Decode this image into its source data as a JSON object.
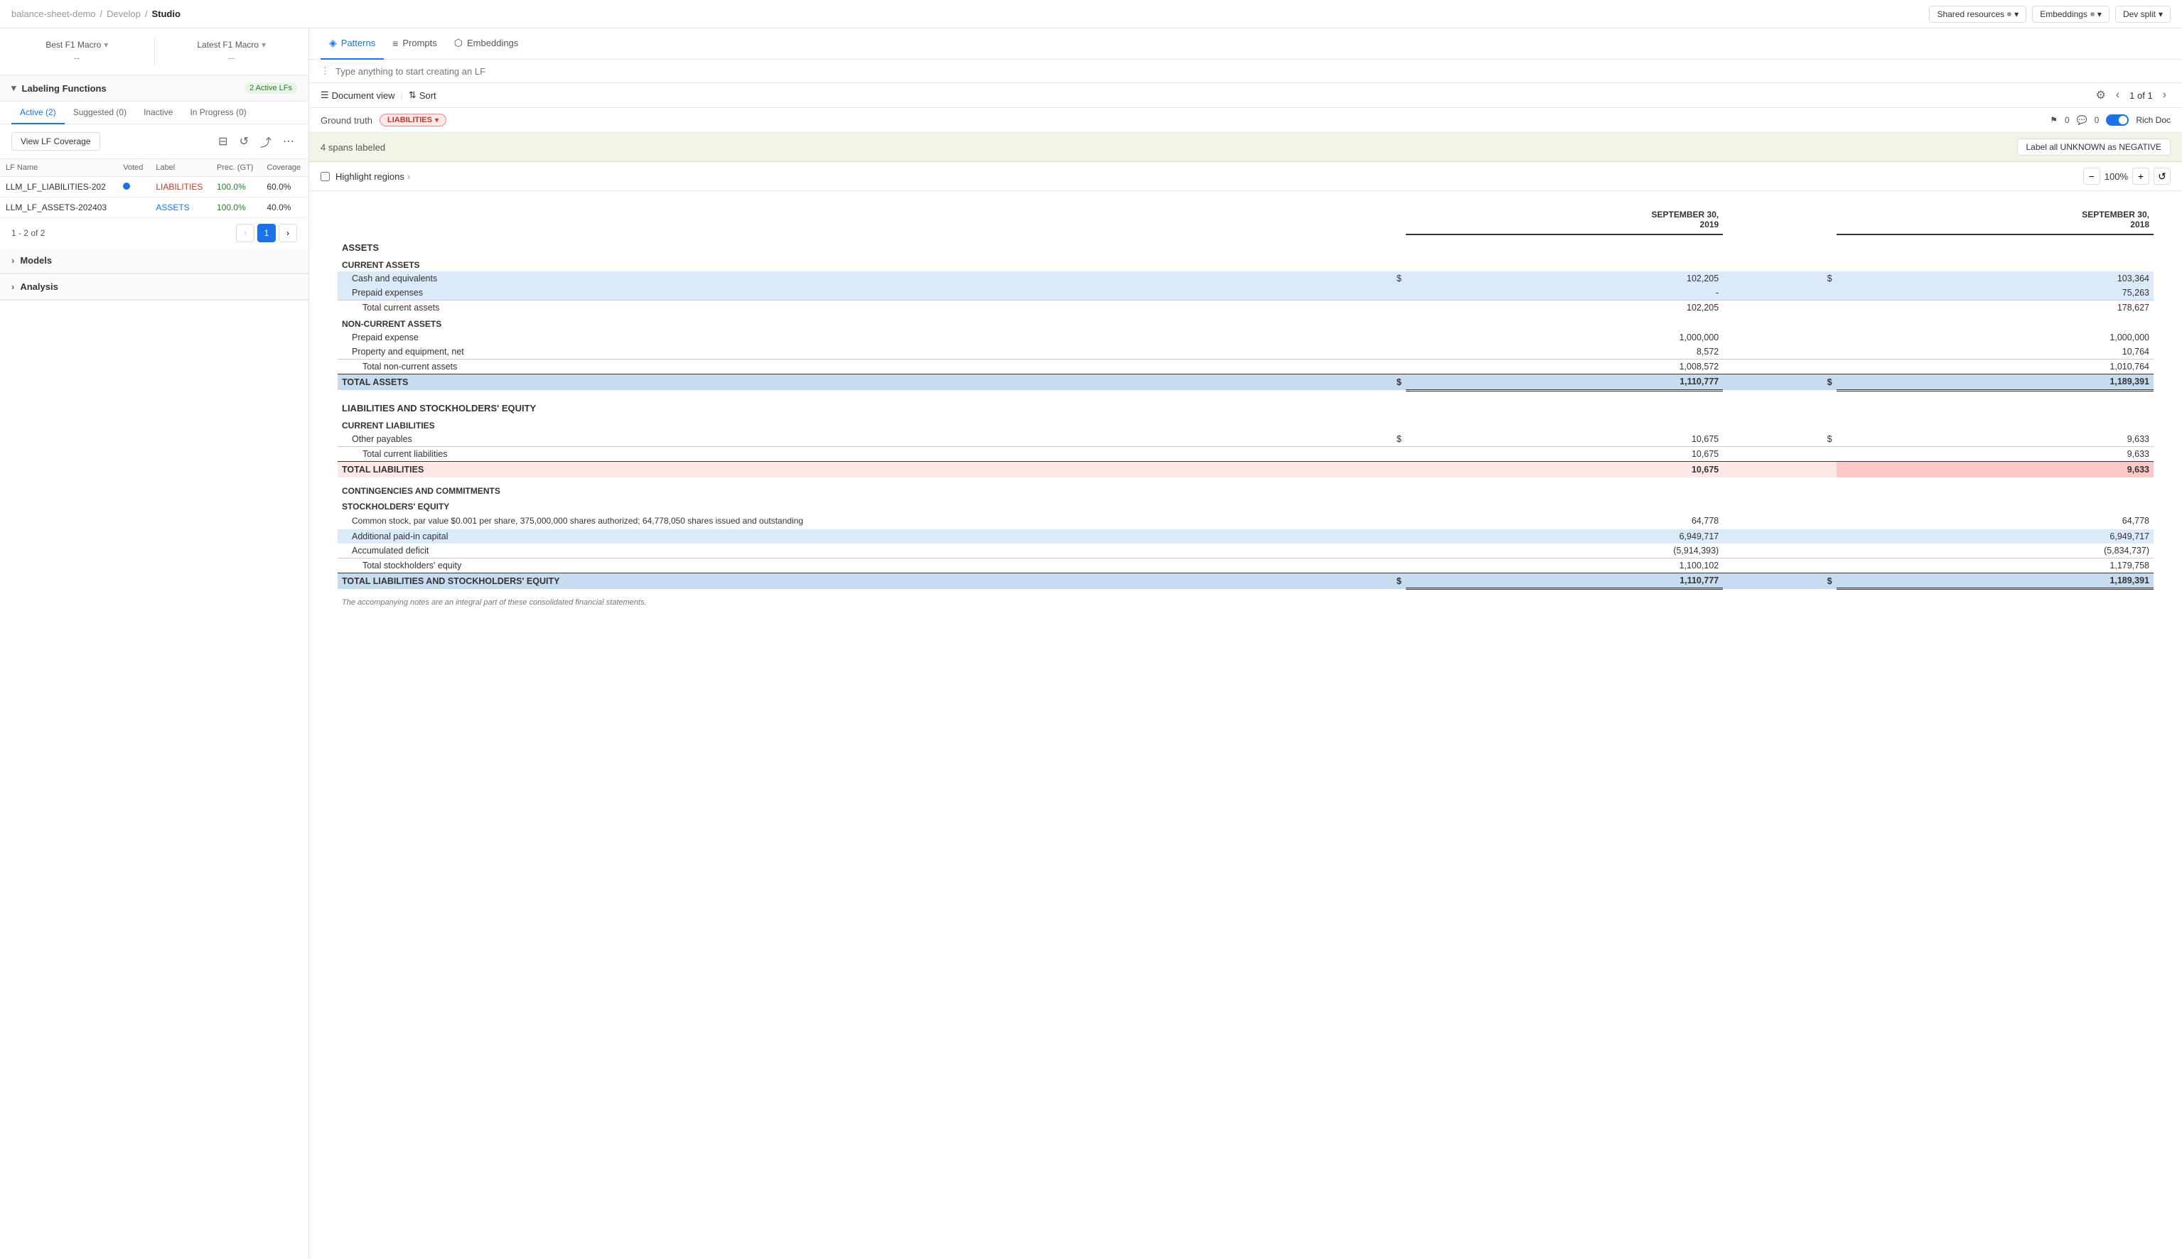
{
  "topbar": {
    "breadcrumb": [
      "balance-sheet-demo",
      "Develop",
      "Studio"
    ],
    "shared_resources": "Shared resources",
    "embeddings": "Embeddings",
    "dev_split": "Dev split"
  },
  "left": {
    "f1": {
      "best_label": "Best F1 Macro",
      "best_value": "--",
      "latest_label": "Latest F1 Macro",
      "latest_value": "--"
    },
    "labeling_functions": {
      "title": "Labeling Functions",
      "badge": "2 Active LFs",
      "tabs": [
        {
          "label": "Active (2)",
          "active": true
        },
        {
          "label": "Suggested (0)",
          "active": false
        },
        {
          "label": "Inactive",
          "active": false
        },
        {
          "label": "In Progress (0)",
          "active": false
        }
      ],
      "view_coverage_btn": "View LF Coverage",
      "columns": [
        "LF Name",
        "Voted",
        "Label",
        "Prec. (GT)",
        "Coverage"
      ],
      "rows": [
        {
          "name": "LLM_LF_LIABILITIES-202",
          "voted": true,
          "label": "LIABILITIES",
          "prec": "100.0%",
          "coverage": "60.0%"
        },
        {
          "name": "LLM_LF_ASSETS-202403",
          "voted": false,
          "label": "ASSETS",
          "prec": "100.0%",
          "coverage": "40.0%"
        }
      ],
      "pagination": {
        "range": "1 - 2 of 2",
        "current_page": 1
      }
    },
    "models": {
      "title": "Models"
    },
    "analysis": {
      "title": "Analysis"
    }
  },
  "right": {
    "tabs": [
      {
        "label": "Patterns",
        "icon": "◈",
        "active": true
      },
      {
        "label": "Prompts",
        "icon": "≡",
        "active": false
      },
      {
        "label": "Embeddings",
        "icon": "⬡",
        "active": false
      }
    ],
    "prompt_placeholder": "Type anything to start creating an LF",
    "doc_toolbar": {
      "document_view": "Document view",
      "sort": "Sort",
      "page_current": "1",
      "page_of": "of",
      "page_total": "1"
    },
    "ground_truth": {
      "label": "Ground truth",
      "badge": "LIABILITIES",
      "icons_count_1": "0",
      "icons_count_2": "0",
      "rich_doc": "Rich Doc"
    },
    "spans_labeled": {
      "text": "4 spans labeled",
      "btn": "Label all UNKNOWN as NEGATIVE"
    },
    "highlight": {
      "label": "Highlight regions",
      "zoom": "100%",
      "zoom_in": "+",
      "zoom_out": "-"
    },
    "document": {
      "col1_header": "SEPTEMBER 30,\n2019",
      "col2_header": "SEPTEMBER 30,\n2018",
      "sections": {
        "assets_title": "ASSETS",
        "current_assets_title": "CURRENT ASSETS",
        "cash": {
          "label": "Cash and equivalents",
          "v1": "102,205",
          "v2": "103,364",
          "sym1": "$",
          "sym2": "$"
        },
        "prepaid_exp": {
          "label": "Prepaid expenses",
          "v1": "-",
          "v2": "75,263"
        },
        "total_current": {
          "label": "Total current assets",
          "v1": "102,205",
          "v2": "178,627"
        },
        "non_current_title": "NON-CURRENT ASSETS",
        "prepaid_expense2": {
          "label": "Prepaid expense",
          "v1": "1,000,000",
          "v2": "1,000,000"
        },
        "property": {
          "label": "Property and equipment, net",
          "v1": "8,572",
          "v2": "10,764"
        },
        "total_non_current": {
          "label": "Total non-current assets",
          "v1": "1,008,572",
          "v2": "1,010,764"
        },
        "total_assets": {
          "label": "TOTAL ASSETS",
          "v1": "1,110,777",
          "v2": "1,189,391",
          "sym1": "$",
          "sym2": "$"
        },
        "liab_equity_title": "LIABILITIES AND STOCKHOLDERS' EQUITY",
        "current_liab_title": "CURRENT LIABILITIES",
        "other_payables": {
          "label": "Other payables",
          "v1": "10,675",
          "v2": "9,633",
          "sym1": "$",
          "sym2": "$"
        },
        "total_current_liab": {
          "label": "Total current liabilities",
          "v1": "10,675",
          "v2": "9,633"
        },
        "total_liab": {
          "label": "TOTAL LIABILITIES",
          "v1": "10,675",
          "v2": "9,633"
        },
        "contingencies_title": "CONTINGENCIES AND COMMITMENTS",
        "stockholders_title": "STOCKHOLDERS' EQUITY",
        "common_stock": {
          "label": "Common stock, par value $0.001 per share, 375,000,000 shares authorized; 64,778,050 shares issued and outstanding",
          "v1": "64,778",
          "v2": "64,778"
        },
        "apic": {
          "label": "Additional paid-in capital",
          "v1": "6,949,717",
          "v2": "6,949,717"
        },
        "accumulated_deficit": {
          "label": "Accumulated deficit",
          "v1": "(5,914,393)",
          "v2": "(5,834,737)"
        },
        "total_equity": {
          "label": "Total stockholders' equity",
          "v1": "1,100,102",
          "v2": "1,179,758"
        },
        "total_liab_equity": {
          "label": "TOTAL LIABILITIES AND STOCKHOLDERS' EQUITY",
          "v1": "1,110,777",
          "v2": "1,189,391",
          "sym1": "$",
          "sym2": "$"
        },
        "footnote": "The accompanying notes are an integral part of these consolidated financial statements."
      }
    }
  }
}
